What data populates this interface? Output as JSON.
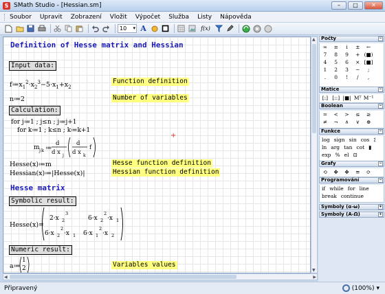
{
  "titlebar": {
    "app_icon": "S",
    "title": "SMath Studio - [Hessian.sm]",
    "buttons": [
      "–",
      "□",
      "✕"
    ]
  },
  "menu": [
    "Soubor",
    "Upravit",
    "Zobrazení",
    "Vložit",
    "Výpočet",
    "Služba",
    "Listy",
    "Nápověda"
  ],
  "toolbar": {
    "font_size": "10",
    "text_tool": "A",
    "fx_label": "f(x)",
    "icons": [
      "new-icon",
      "open-icon",
      "save-icon",
      "print-icon",
      "cut-icon",
      "copy-icon",
      "paste-icon",
      "undo-icon",
      "redo-icon",
      "text-color-icon",
      "highlight-icon",
      "border-icon",
      "table-icon",
      "insert-image-icon",
      "function-icon",
      "filter-icon",
      "calculate-icon",
      "stop-icon",
      "help-icon"
    ]
  },
  "worksheet": {
    "heading1": "Definition of Hesse matrix and Hessian",
    "input_label": "Input data:",
    "func_def": "Function definition",
    "n_expr": "n≔2",
    "nvars": "Number of variables",
    "calc_label": "Calculation:",
    "loop_j": "for j≔1 ; j≤n ; j≔j+1",
    "loop_k": "for k≔1 ; k≤n ; k≔k+1",
    "hesse_assign": "Hesse(x)≔m",
    "hessian_assign": "Hessian(x)≔|Hesse(x)|",
    "hesse_func": "Hesse function definition",
    "hessian_func": "Hessian function definition",
    "heading2": "Hesse matrix",
    "symbolic_label": "Symbolic result:",
    "hesse_lhs": "Hesse(x)=",
    "numeric_label": "Numeric result:",
    "a_lhs": "a≔",
    "a_vals": [
      "1",
      "2"
    ],
    "var_values": "Variables values"
  },
  "palette": {
    "sections": [
      {
        "title": "Počty",
        "rows": [
          [
            "∞",
            "π",
            "i",
            "±",
            "←"
          ],
          [
            "7",
            "8",
            "9",
            "+",
            "(■)"
          ],
          [
            "4",
            "5",
            "6",
            "×",
            "[■]"
          ],
          [
            "1",
            "2",
            "3",
            "−",
            ";"
          ],
          [
            ".",
            "0",
            "!",
            "/",
            ","
          ]
        ]
      },
      {
        "title": "Matice",
        "rows": [
          [
            "[:]",
            "[::]",
            "|■|",
            "Mᵀ",
            "M⁻¹"
          ]
        ]
      },
      {
        "title": "Boolean",
        "rows": [
          [
            "=",
            "<",
            ">",
            "≤",
            "≥"
          ],
          [
            "≠",
            "¬",
            "∧",
            "∨",
            "⊕"
          ]
        ]
      },
      {
        "title": "Funkce",
        "rows": [
          [
            "log",
            "sign",
            "sin",
            "cos",
            "⁒"
          ],
          [
            "ln",
            "arg",
            "tan",
            "cot",
            "▮"
          ],
          [
            "exp",
            "%",
            "el",
            "⊡"
          ]
        ]
      },
      {
        "title": "Grafy",
        "rows": [
          [
            "⟲",
            "✥",
            "✥",
            "≡",
            "⟳"
          ]
        ]
      },
      {
        "title": "Programování",
        "rows": [
          [
            "if",
            "while",
            "for",
            "line"
          ],
          [
            "break",
            "continue"
          ]
        ]
      },
      {
        "title": "Symboly (α-ω)",
        "collapsed": true
      },
      {
        "title": "Symboly (Α-Ω)",
        "collapsed": true
      }
    ]
  },
  "status": {
    "text": "Připravený",
    "zoom": "(100%)"
  }
}
